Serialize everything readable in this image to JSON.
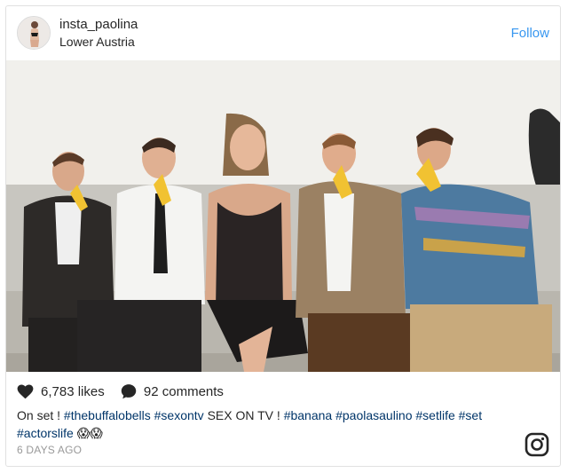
{
  "header": {
    "username": "insta_paolina",
    "location": "Lower Austria",
    "follow_label": "Follow"
  },
  "stats": {
    "likes": "6,783 likes",
    "comments": "92 comments"
  },
  "caption": {
    "prefix": "On set !",
    "tag1": "#thebuffalobells",
    "tag2": "#sexontv",
    "middle": "SEX ON TV !",
    "tag3": "#banana",
    "tag4": "#paolasaulino",
    "tag5": "#setlife",
    "tag6": "#set",
    "tag7": "#actorslife",
    "emoji": "😱😱"
  },
  "timestamp": "6 DAYS AGO",
  "icons": [
    "heart-icon",
    "comment-icon",
    "instagram-logo-icon"
  ],
  "colors": {
    "link": "#3897f0",
    "hashtag": "#003569",
    "muted": "#999999"
  }
}
